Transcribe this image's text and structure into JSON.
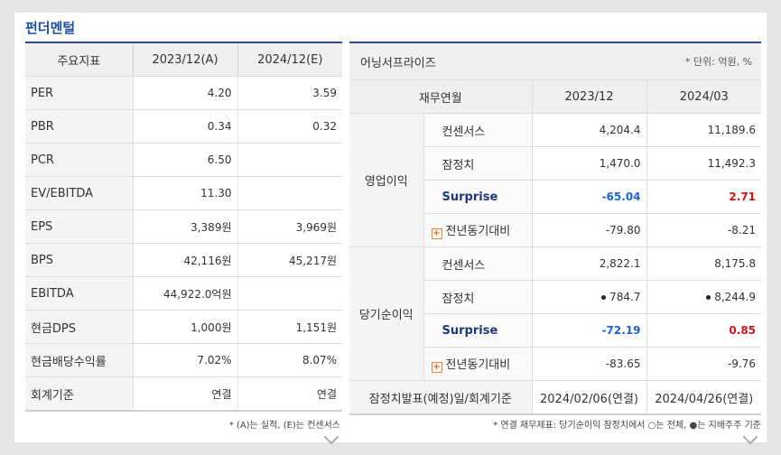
{
  "section_title": "펀더멘털",
  "left": {
    "headers": [
      "주요지표",
      "2023/12(A)",
      "2024/12(E)"
    ],
    "rows": [
      {
        "label": "PER",
        "a": "4.20",
        "e": "3.59"
      },
      {
        "label": "PBR",
        "a": "0.34",
        "e": "0.32"
      },
      {
        "label": "PCR",
        "a": "6.50",
        "e": ""
      },
      {
        "label": "EV/EBITDA",
        "a": "11.30",
        "e": ""
      },
      {
        "label": "EPS",
        "a": "3,389원",
        "e": "3,969원"
      },
      {
        "label": "BPS",
        "a": "42,116원",
        "e": "45,217원"
      },
      {
        "label": "EBITDA",
        "a": "44,922.0억원",
        "e": ""
      },
      {
        "label": "현금DPS",
        "a": "1,000원",
        "e": "1,151원"
      },
      {
        "label": "현금배당수익률",
        "a": "7.02%",
        "e": "8.07%"
      },
      {
        "label": "회계기준",
        "a": "연결",
        "e": "연결"
      }
    ],
    "note": "* (A)는 실적, (E)는 컨센서스"
  },
  "right": {
    "title": "어닝서프라이즈",
    "unit": "* 단위: 억원, %",
    "headers": [
      "재무연월",
      "2023/12",
      "2024/03"
    ],
    "op_group": "영업이익",
    "net_group": "당기순이익",
    "op": {
      "consensus": {
        "label": "컨센서스",
        "v1": "4,204.4",
        "v2": "11,189.6"
      },
      "prelim": {
        "label": "잠정치",
        "v1": "1,470.0",
        "v2": "11,492.3"
      },
      "surprise": {
        "label": "Surprise",
        "v1": "-65.04",
        "v2": "2.71"
      },
      "yoy": {
        "label": "전년동기대비",
        "v1": "-79.80",
        "v2": "-8.21"
      }
    },
    "net": {
      "consensus": {
        "label": "컨센서스",
        "v1": "2,822.1",
        "v2": "8,175.8"
      },
      "prelim": {
        "label": "잠정치",
        "v1": "784.7",
        "v2": "8,244.9"
      },
      "surprise": {
        "label": "Surprise",
        "v1": "-72.19",
        "v2": "0.85"
      },
      "yoy": {
        "label": "전년동기대비",
        "v1": "-83.65",
        "v2": "-9.76"
      }
    },
    "footer_label": "잠정치발표(예정)일/회계기준",
    "footer_v1": "2024/02/06(연결)",
    "footer_v2": "2024/04/26(연결)",
    "note": "* 연결 재무제표: 당기순이익 잠정치에서 ○는 전체, ●는 지배주주 기준"
  },
  "colors": {
    "accent": "#1f4e99",
    "negative": "#1f64c8",
    "positive": "#d01515"
  }
}
